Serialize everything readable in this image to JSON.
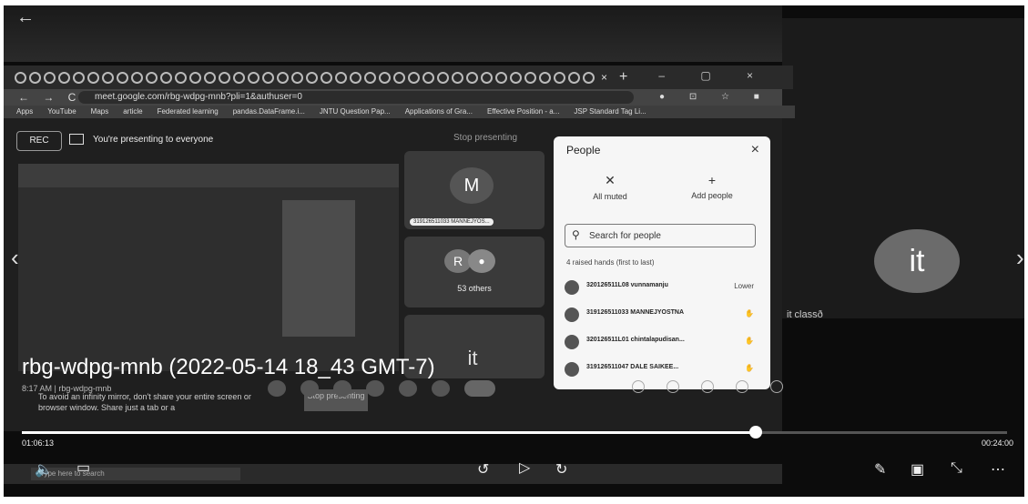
{
  "window": {
    "back_glyph": "←",
    "prev_glyph": "‹",
    "next_glyph": "›"
  },
  "browser": {
    "url": "meet.google.com/rbg-wdpg-mnb?pli=1&authuser=0",
    "tab_close": "×",
    "tab_new": "+",
    "window_controls": "–  ▢  ×",
    "nav_buttons": "← → C",
    "bookmarks": [
      "Apps",
      "YouTube",
      "Maps",
      "article",
      "Federated learning",
      "pandas.DataFrame.i...",
      "JNTU Question Pap...",
      "Applications of Gra...",
      "Effective Position - a...",
      "JSP Standard Tag Li..."
    ]
  },
  "meet": {
    "rec_label": "REC",
    "presenting_text": "You're presenting to everyone",
    "stop_presenting": "Stop presenting",
    "mirror_warning": "To avoid an infinity mirror, don't share your entire screen or browser window. Share just a tab or a",
    "stop_btn": "Stop presenting",
    "tile1_initial": "M",
    "tile1_name": "319126511033 MANNEJYOS...",
    "tile2_initial": "R",
    "tile2_others": "53 others",
    "tile3_initial": "it",
    "clock": "8:17 AM",
    "meeting_code": "rbg-wdpg-mnb"
  },
  "people": {
    "title": "People",
    "close": "×",
    "all_muted": "All muted",
    "add_people": "Add people",
    "search_placeholder": "Search for people",
    "raised_header": "4 raised hands (first to last)",
    "rows": [
      {
        "name": "320126511L08 vunnamanju",
        "action": "Lower"
      },
      {
        "name": "319126511033 MANNEJYOSTNA",
        "action": "✋"
      },
      {
        "name": "320126511L01 chintalapudisan...",
        "action": "✋"
      },
      {
        "name": "319126511047 DALE SAIKEE...",
        "action": "✋"
      }
    ]
  },
  "taskbar": {
    "search_placeholder": "Type here to search"
  },
  "sidebar": {
    "avatar_text": "it",
    "label": "it classð"
  },
  "video": {
    "title": "rbg-wdpg-mnb (2022-05-14 18_43 GMT-7)",
    "elapsed": "01:06:13",
    "total": "00:24:00",
    "progress": 0.745
  }
}
